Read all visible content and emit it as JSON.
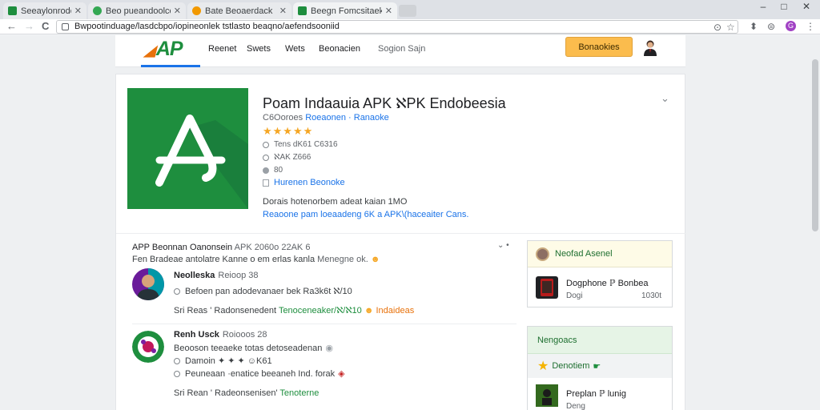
{
  "browser": {
    "tabs": [
      {
        "title": "Seeaylonrodole",
        "favicon_color": "#1e8e3e",
        "active": false
      },
      {
        "title": "Beo pueandoolcose",
        "favicon_color": "#34a853",
        "active": false
      },
      {
        "title": "Bate Beoaerdack",
        "favicon_color": "#f29900",
        "active": false
      },
      {
        "title": "Beegn Fomcsitaek",
        "favicon_color": "#1e8e3e",
        "active": true
      }
    ],
    "window_controls": {
      "minimize": "–",
      "maximize": "□",
      "close": "✕"
    },
    "nav": {
      "back": "←",
      "forward": "→",
      "reload": "C"
    },
    "address": "Bwpootinduage/lasdcbpo/iopineonlek tstlasto beaqno/aefendsooniid",
    "omnibox_icons": {
      "zoom": "⊙",
      "bookmark": "☆"
    },
    "extensions": {
      "ext1": "⬍",
      "ext2": "⊜",
      "profile": "G",
      "menu": "⋮"
    }
  },
  "header": {
    "logo": "AP",
    "menu": [
      "Reenet",
      "Swets",
      "Wets",
      "Beonacien",
      "Sogion Sajn"
    ],
    "button": "Bonaokies"
  },
  "app": {
    "title": "Poam Indaauia APK ℵPK Endobeesia",
    "developer": "C6Ooroes",
    "category": "Roeaonen · Ranaoke",
    "stars": "★★★★★",
    "meta": [
      "Tens  dK61  C6316",
      "ℵAK  Z666",
      "80"
    ],
    "install_link": "Hurenen Beonoke",
    "description": "Dorais  hotenorbem adeat kaian  1MO",
    "description_link": "Reaoone pam loeaadeng  6K a APK\\(haceaiter  Cans."
  },
  "reviews": {
    "heading": "APP Beonnan Oanonsein",
    "heading_meta": "APK 2060o 22AK 6",
    "subheading": "Fen Bradeae antolatre  Kanne o em erlas kanla",
    "subheading_link": "Menegne ok.",
    "chevron": "⌄ •",
    "items": [
      {
        "name": "Neolleska",
        "name_meta": "Reioop 38",
        "line1": "Befoen  pan adodevanaer  bek  Ra3k6t  ℵ/10",
        "line2": "",
        "foot_label": "Sri  Reas  ' Radonsenedent  ",
        "foot_hl": "Tenoceneaker/ℵ/ℵ10",
        "foot_hl2": "Indaideas"
      },
      {
        "name": "Renh Usck",
        "name_meta": "Roiooos 28",
        "line1": "Beooson  teeaeke  totas  detoseadenan",
        "line2": "Damoin  ✦  ✦  ✦ ☺K61",
        "line3": "Peuneaan  ·enatice  beeaneh  Ind.  forak",
        "foot_label": "Sri  Rean  ' Radeonsenisen'  ",
        "foot_hl": "Tenoterne",
        "foot_hl2": ""
      }
    ]
  },
  "sidebar": {
    "box1": {
      "title": "Neofad Asenel",
      "item_title": "Dogphone ℙ Bonbea",
      "item_left": "Dogi",
      "item_right": "1030t"
    },
    "box2": {
      "title": "Nengoacs",
      "row": "Denotiem",
      "item_title": "Preplan  ℙ  lunig",
      "item_sub": "Deng"
    }
  },
  "colors": {
    "brand_green": "#1e8e3e",
    "accent_orange": "#fbbc4d",
    "link_blue": "#1a73e8",
    "star": "#f5a623"
  }
}
